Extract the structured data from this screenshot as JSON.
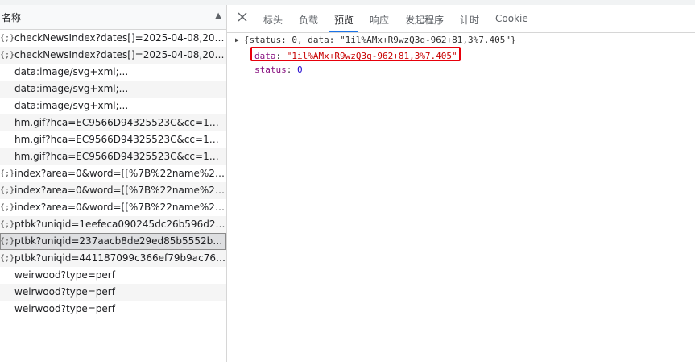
{
  "header": {
    "name_label": "名称"
  },
  "requests": [
    {
      "icon": "{;}",
      "name": "checkNewsIndex?dates[]=2025-04-08,2025..."
    },
    {
      "icon": "{;}",
      "name": "checkNewsIndex?dates[]=2025-04-08,2025..."
    },
    {
      "icon": "",
      "name": "data:image/svg+xml;..."
    },
    {
      "icon": "",
      "name": "data:image/svg+xml;..."
    },
    {
      "icon": "",
      "name": "data:image/svg+xml;..."
    },
    {
      "icon": "",
      "name": "hm.gif?hca=EC9566D94325523C&cc=1&c..."
    },
    {
      "icon": "",
      "name": "hm.gif?hca=EC9566D94325523C&cc=1&c..."
    },
    {
      "icon": "",
      "name": "hm.gif?hca=EC9566D94325523C&cc=1&c..."
    },
    {
      "icon": "{;}",
      "name": "index?area=0&word=[[%7B%22name%22:..."
    },
    {
      "icon": "{;}",
      "name": "index?area=0&word=[[%7B%22name%22:..."
    },
    {
      "icon": "{;}",
      "name": "index?area=0&word=[[%7B%22name%22:..."
    },
    {
      "icon": "{;}",
      "name": "ptbk?uniqid=1eefeca090245dc26b596d2a..."
    },
    {
      "icon": "{;}",
      "name": "ptbk?uniqid=237aacb8de29ed85b5552b1a...",
      "selected": true
    },
    {
      "icon": "{;}",
      "name": "ptbk?uniqid=441187099c366ef79b9ac766a..."
    },
    {
      "icon": "",
      "name": "weirwood?type=perf"
    },
    {
      "icon": "",
      "name": "weirwood?type=perf"
    },
    {
      "icon": "",
      "name": "weirwood?type=perf"
    }
  ],
  "tabs": [
    {
      "label": "标头"
    },
    {
      "label": "负载"
    },
    {
      "label": "预览",
      "active": true
    },
    {
      "label": "响应"
    },
    {
      "label": "发起程序"
    },
    {
      "label": "计时"
    },
    {
      "label": "Cookie"
    }
  ],
  "preview": {
    "summary": "{status: 0, data: \"1il%AMx+R9wzQ3q-962+81,3%7.405\"}",
    "data_key": "data",
    "data_value": "\"1il%AMx+R9wzQ3q-962+81,3%7.405\"",
    "status_key": "status",
    "status_value": "0"
  },
  "colors": {
    "highlight_box": "#e8000b",
    "active_tab": "#1a73e8"
  }
}
